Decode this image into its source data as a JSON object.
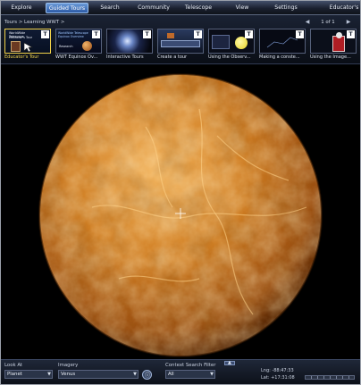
{
  "menu": {
    "items": [
      {
        "label": "Explore",
        "active": false
      },
      {
        "label": "Guided Tours",
        "active": true
      },
      {
        "label": "Search",
        "active": false
      },
      {
        "label": "Community",
        "active": false
      },
      {
        "label": "Telescope",
        "active": false
      },
      {
        "label": "View",
        "active": false
      },
      {
        "label": "Settings",
        "active": false
      },
      {
        "label": "Educator's",
        "active": false
      }
    ]
  },
  "tours": {
    "breadcrumb": "Tours > Learning WWT >",
    "pager": {
      "text": "1 of 1",
      "prev_icon": "chevron-left-icon",
      "next_icon": "chevron-right-icon"
    },
    "items": [
      {
        "caption": "Educator's Tour",
        "selected": true
      },
      {
        "caption": "WWT Equinox Ov...",
        "selected": false
      },
      {
        "caption": "Interactive Tours",
        "selected": false
      },
      {
        "caption": "Create a tour",
        "selected": false
      },
      {
        "caption": "Using the Observ...",
        "selected": false
      },
      {
        "caption": "Making a conste...",
        "selected": false
      },
      {
        "caption": "Using the Image...",
        "selected": false
      }
    ],
    "thumb_texts": {
      "t0_line1": "WorldWide Telescope",
      "t0_line2": "Educator's Tour",
      "t1_line1": "WorldWide Telescope",
      "t1_line2": "Equinox Overview",
      "t1_line3": "Research"
    },
    "badge": "T"
  },
  "sky": {
    "target": "Venus",
    "planet_color": "#c87a22"
  },
  "bottom": {
    "look_at_label": "Look At",
    "look_at_value": "Planet",
    "imagery_label": "Imagery",
    "imagery_value": "Venus",
    "context_label": "Context Search Filter",
    "context_value": "All",
    "lng": "Lng:  -88:47:33",
    "lat": "Lat:   +17:31:08"
  },
  "colors": {
    "accent": "#2c5aa5",
    "selected_caption": "#f4d84f"
  }
}
